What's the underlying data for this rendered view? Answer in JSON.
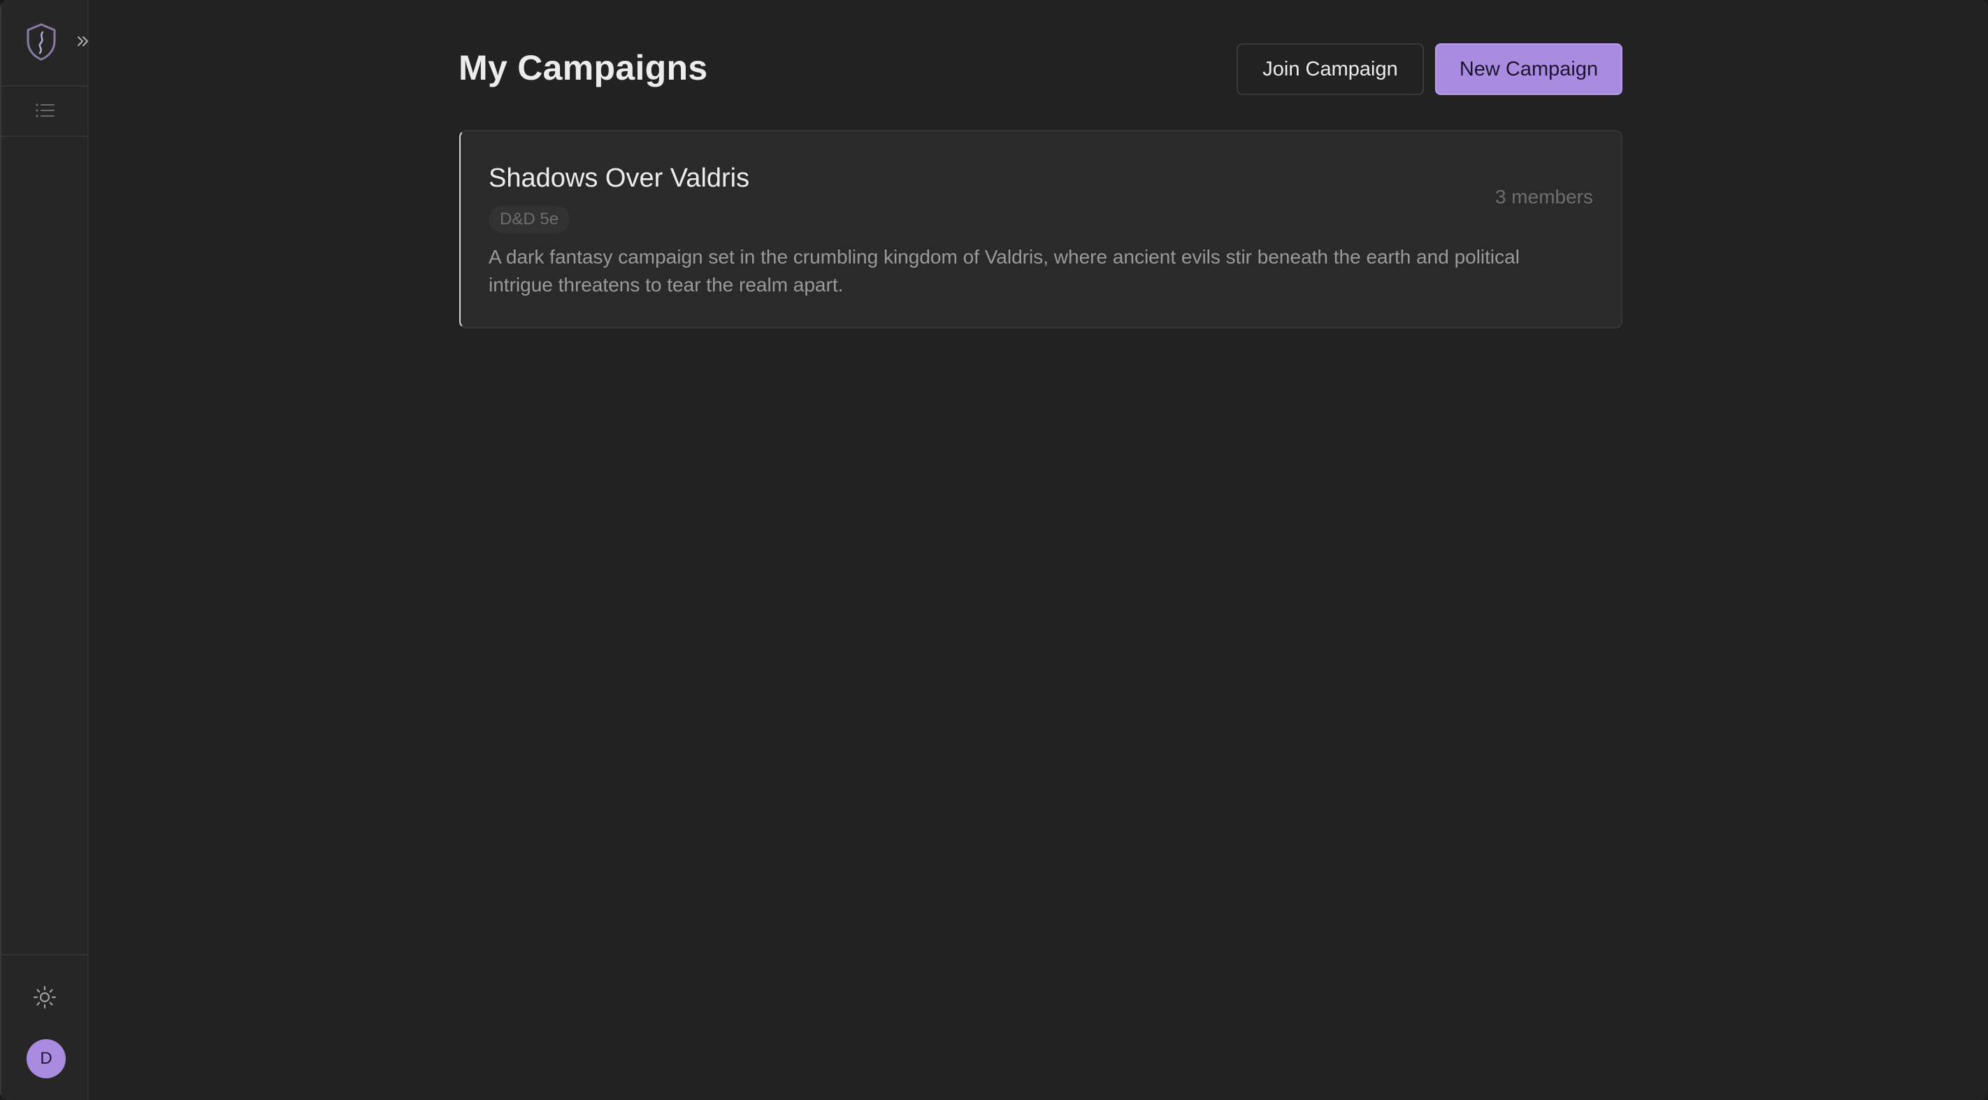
{
  "app": {
    "colors": {
      "accent": "#a98be0",
      "background": "#222222",
      "sidebar": "#262626",
      "card": "#2a2a2a"
    }
  },
  "sidebar": {
    "logo_icon": "shield-icon",
    "expand_icon": "chevrons-right-icon",
    "nav_icon": "list-icon",
    "theme_icon": "sun-icon",
    "avatar_initial": "D"
  },
  "header": {
    "title": "My Campaigns",
    "join_label": "Join Campaign",
    "new_label": "New Campaign"
  },
  "campaigns": [
    {
      "name": "Shadows Over Valdris",
      "system": "D&D 5e",
      "members": "3 members",
      "description": "A dark fantasy campaign set in the crumbling kingdom of Valdris, where ancient evils stir beneath the earth and political intrigue threatens to tear the realm apart."
    }
  ]
}
